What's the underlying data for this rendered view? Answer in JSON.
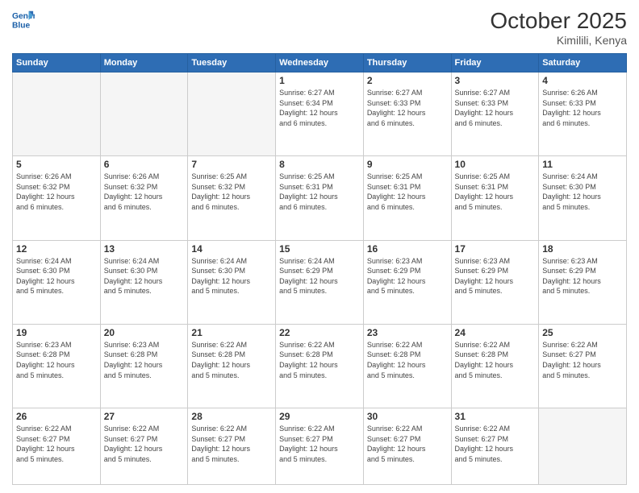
{
  "header": {
    "logo_line1": "General",
    "logo_line2": "Blue",
    "month": "October 2025",
    "location": "Kimilili, Kenya"
  },
  "weekdays": [
    "Sunday",
    "Monday",
    "Tuesday",
    "Wednesday",
    "Thursday",
    "Friday",
    "Saturday"
  ],
  "weeks": [
    [
      {
        "day": "",
        "info": ""
      },
      {
        "day": "",
        "info": ""
      },
      {
        "day": "",
        "info": ""
      },
      {
        "day": "1",
        "info": "Sunrise: 6:27 AM\nSunset: 6:34 PM\nDaylight: 12 hours\nand 6 minutes."
      },
      {
        "day": "2",
        "info": "Sunrise: 6:27 AM\nSunset: 6:33 PM\nDaylight: 12 hours\nand 6 minutes."
      },
      {
        "day": "3",
        "info": "Sunrise: 6:27 AM\nSunset: 6:33 PM\nDaylight: 12 hours\nand 6 minutes."
      },
      {
        "day": "4",
        "info": "Sunrise: 6:26 AM\nSunset: 6:33 PM\nDaylight: 12 hours\nand 6 minutes."
      }
    ],
    [
      {
        "day": "5",
        "info": "Sunrise: 6:26 AM\nSunset: 6:32 PM\nDaylight: 12 hours\nand 6 minutes."
      },
      {
        "day": "6",
        "info": "Sunrise: 6:26 AM\nSunset: 6:32 PM\nDaylight: 12 hours\nand 6 minutes."
      },
      {
        "day": "7",
        "info": "Sunrise: 6:25 AM\nSunset: 6:32 PM\nDaylight: 12 hours\nand 6 minutes."
      },
      {
        "day": "8",
        "info": "Sunrise: 6:25 AM\nSunset: 6:31 PM\nDaylight: 12 hours\nand 6 minutes."
      },
      {
        "day": "9",
        "info": "Sunrise: 6:25 AM\nSunset: 6:31 PM\nDaylight: 12 hours\nand 6 minutes."
      },
      {
        "day": "10",
        "info": "Sunrise: 6:25 AM\nSunset: 6:31 PM\nDaylight: 12 hours\nand 5 minutes."
      },
      {
        "day": "11",
        "info": "Sunrise: 6:24 AM\nSunset: 6:30 PM\nDaylight: 12 hours\nand 5 minutes."
      }
    ],
    [
      {
        "day": "12",
        "info": "Sunrise: 6:24 AM\nSunset: 6:30 PM\nDaylight: 12 hours\nand 5 minutes."
      },
      {
        "day": "13",
        "info": "Sunrise: 6:24 AM\nSunset: 6:30 PM\nDaylight: 12 hours\nand 5 minutes."
      },
      {
        "day": "14",
        "info": "Sunrise: 6:24 AM\nSunset: 6:30 PM\nDaylight: 12 hours\nand 5 minutes."
      },
      {
        "day": "15",
        "info": "Sunrise: 6:24 AM\nSunset: 6:29 PM\nDaylight: 12 hours\nand 5 minutes."
      },
      {
        "day": "16",
        "info": "Sunrise: 6:23 AM\nSunset: 6:29 PM\nDaylight: 12 hours\nand 5 minutes."
      },
      {
        "day": "17",
        "info": "Sunrise: 6:23 AM\nSunset: 6:29 PM\nDaylight: 12 hours\nand 5 minutes."
      },
      {
        "day": "18",
        "info": "Sunrise: 6:23 AM\nSunset: 6:29 PM\nDaylight: 12 hours\nand 5 minutes."
      }
    ],
    [
      {
        "day": "19",
        "info": "Sunrise: 6:23 AM\nSunset: 6:28 PM\nDaylight: 12 hours\nand 5 minutes."
      },
      {
        "day": "20",
        "info": "Sunrise: 6:23 AM\nSunset: 6:28 PM\nDaylight: 12 hours\nand 5 minutes."
      },
      {
        "day": "21",
        "info": "Sunrise: 6:22 AM\nSunset: 6:28 PM\nDaylight: 12 hours\nand 5 minutes."
      },
      {
        "day": "22",
        "info": "Sunrise: 6:22 AM\nSunset: 6:28 PM\nDaylight: 12 hours\nand 5 minutes."
      },
      {
        "day": "23",
        "info": "Sunrise: 6:22 AM\nSunset: 6:28 PM\nDaylight: 12 hours\nand 5 minutes."
      },
      {
        "day": "24",
        "info": "Sunrise: 6:22 AM\nSunset: 6:28 PM\nDaylight: 12 hours\nand 5 minutes."
      },
      {
        "day": "25",
        "info": "Sunrise: 6:22 AM\nSunset: 6:27 PM\nDaylight: 12 hours\nand 5 minutes."
      }
    ],
    [
      {
        "day": "26",
        "info": "Sunrise: 6:22 AM\nSunset: 6:27 PM\nDaylight: 12 hours\nand 5 minutes."
      },
      {
        "day": "27",
        "info": "Sunrise: 6:22 AM\nSunset: 6:27 PM\nDaylight: 12 hours\nand 5 minutes."
      },
      {
        "day": "28",
        "info": "Sunrise: 6:22 AM\nSunset: 6:27 PM\nDaylight: 12 hours\nand 5 minutes."
      },
      {
        "day": "29",
        "info": "Sunrise: 6:22 AM\nSunset: 6:27 PM\nDaylight: 12 hours\nand 5 minutes."
      },
      {
        "day": "30",
        "info": "Sunrise: 6:22 AM\nSunset: 6:27 PM\nDaylight: 12 hours\nand 5 minutes."
      },
      {
        "day": "31",
        "info": "Sunrise: 6:22 AM\nSunset: 6:27 PM\nDaylight: 12 hours\nand 5 minutes."
      },
      {
        "day": "",
        "info": ""
      }
    ]
  ]
}
